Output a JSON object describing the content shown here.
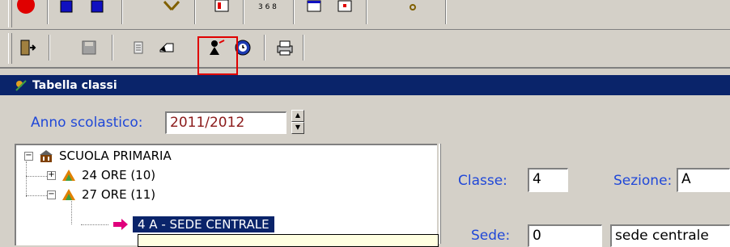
{
  "window": {
    "title": "Tabella classi"
  },
  "year": {
    "label": "Anno scolastico:",
    "value": "2011/2012"
  },
  "tree": {
    "root": "SCUOLA PRIMARIA",
    "nodes": [
      "24 ORE (10)",
      "27 ORE (11)"
    ],
    "selected": "4 A  - SEDE CENTRALE"
  },
  "detail": {
    "classe_label": "Classe:",
    "classe_value": "4",
    "sezione_label": "Sezione:",
    "sezione_value": "A",
    "sede_label": "Sede:",
    "sede_code": "0",
    "sede_name": "sede centrale"
  },
  "colors": {
    "titlebar": "#0a246a",
    "label": "#2048d8",
    "year_value": "#8b1a1a",
    "highlight": "#e00000"
  }
}
